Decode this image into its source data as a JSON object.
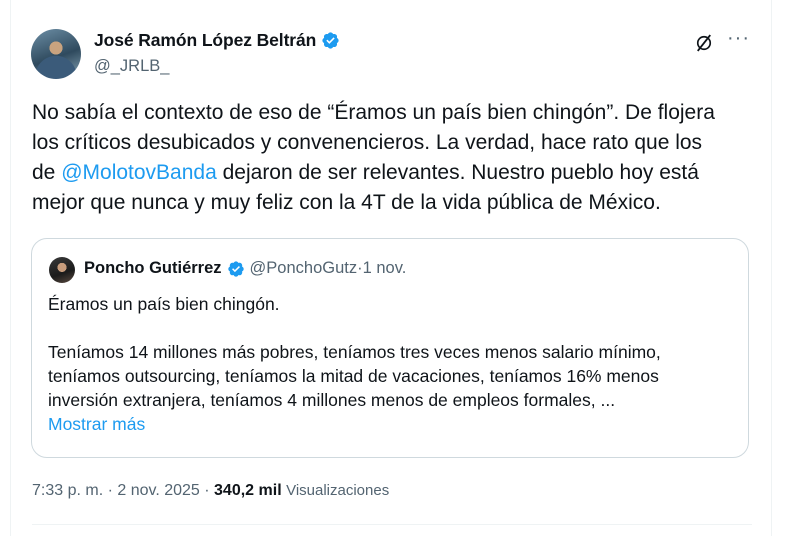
{
  "tweet": {
    "author_name": "José Ramón López Beltrán",
    "author_handle": "@_JRLB_",
    "text_lines": [
      "No sabía el contexto de eso de “Éramos un país bien chingón”. De flojera",
      "los críticos desubicados y convenencieros. La verdad, hace rato que los"
    ],
    "line3_prefix": "de ",
    "mention": "@MolotovBanda",
    "line3_suffix": " dejaron de ser relevantes. Nuestro pueblo hoy está",
    "line4": "mejor que nunca y muy feliz con la 4T de la vida pública de México.",
    "icons": {
      "verified": "verified-badge-icon",
      "grok": "grok-icon",
      "more": "more-icon"
    }
  },
  "quote": {
    "author_name": "Poncho Gutiérrez",
    "author_handle": "@PonchoGutz",
    "separator": " · ",
    "date": "1 nov.",
    "lines": [
      "Éramos un país bien chingón.",
      "Teníamos 14 millones más pobres, teníamos tres veces menos salario mínimo,",
      "teníamos outsourcing, teníamos la mitad de vacaciones, teníamos 16% menos",
      "inversión extranjera, teníamos 4 millones menos de empleos formales, ..."
    ],
    "show_more": "Mostrar más"
  },
  "meta": {
    "time": "7:33 p. m.",
    "separator": " · ",
    "date": "2 nov. 2025",
    "views_count": "340,2 mil",
    "views_label": "Visualizaciones"
  },
  "colors": {
    "accent": "#1d9bf0",
    "text": "#0f1419",
    "secondary": "#536471",
    "border": "#cfd9de"
  }
}
